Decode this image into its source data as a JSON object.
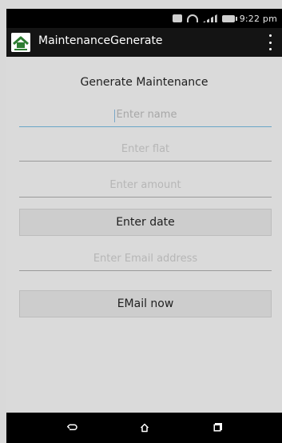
{
  "statusbar": {
    "time": "9:22 pm"
  },
  "appbar": {
    "title": "MaintenanceGenerate",
    "icons": {
      "logo": "app-logo-icon",
      "overflow": "overflow-menu-icon"
    }
  },
  "screen": {
    "heading": "Generate Maintenance",
    "fields": {
      "name_placeholder": "Enter name",
      "flat_placeholder": "Enter flat",
      "amount_placeholder": "Enter amount",
      "email_placeholder": "Enter Email address"
    },
    "buttons": {
      "enter_date_label": "Enter date",
      "email_now_label": "EMail now"
    }
  },
  "navigation": {
    "back": "back-icon",
    "home": "home-icon",
    "recent": "recent-apps-icon"
  },
  "colors": {
    "status_bar_bg": "#000000",
    "app_bar_bg": "#141414",
    "content_bg": "#dadada",
    "active_underline": "#6aa6c7",
    "button_bg": "#cdcdcd"
  }
}
